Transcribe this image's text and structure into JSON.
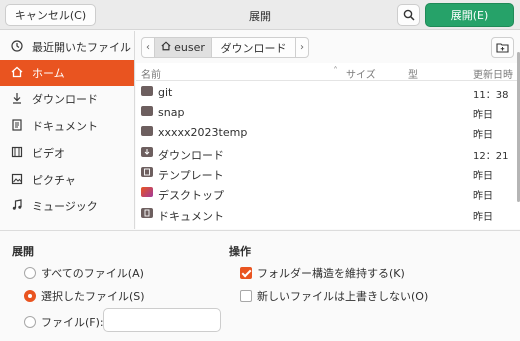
{
  "header": {
    "cancel_label": "キャンセル(C)",
    "title": "展開",
    "open_label": "展開(E)",
    "search_icon": "search-icon"
  },
  "sidebar": {
    "items": [
      {
        "label": "最近開いたファイル",
        "icon": "clock-icon"
      },
      {
        "label": "ホーム",
        "icon": "home-icon"
      },
      {
        "label": "ダウンロード",
        "icon": "download-icon"
      },
      {
        "label": "ドキュメント",
        "icon": "document-icon"
      },
      {
        "label": "ビデオ",
        "icon": "film-icon"
      },
      {
        "label": "ピクチャ",
        "icon": "picture-icon"
      },
      {
        "label": "ミュージック",
        "icon": "music-icon"
      }
    ]
  },
  "pathbar": {
    "segments": [
      "euser",
      "ダウンロード"
    ]
  },
  "columns": {
    "name": "名前",
    "size": "サイズ",
    "type": "型",
    "modified": "更新日時"
  },
  "files": [
    {
      "name": "git",
      "modified": "11：38",
      "icon": "folder-icon"
    },
    {
      "name": "snap",
      "modified": "昨日",
      "icon": "folder-icon"
    },
    {
      "name": "xxxxx2023temp",
      "modified": "昨日",
      "icon": "folder-icon"
    },
    {
      "name": "ダウンロード",
      "modified": "12：21",
      "icon": "download-folder-icon"
    },
    {
      "name": "テンプレート",
      "modified": "昨日",
      "icon": "template-folder-icon"
    },
    {
      "name": "デスクトップ",
      "modified": "昨日",
      "icon": "desktop-folder-icon"
    },
    {
      "name": "ドキュメント",
      "modified": "昨日",
      "icon": "documents-folder-icon"
    }
  ],
  "extract": {
    "title": "展開",
    "all_files": "すべてのファイル(A)",
    "selected_files": "選択したファイル(S)",
    "files_label": "ファイル(F):",
    "files_value": "",
    "selected_option": "selected_files"
  },
  "actions": {
    "title": "操作",
    "keep_structure": "フォルダー構造を維持する(K)",
    "keep_structure_checked": true,
    "no_overwrite": "新しいファイルは上書きしない(O)",
    "no_overwrite_checked": false
  },
  "colors": {
    "accent": "#e95420",
    "open_button": "#26a269"
  }
}
